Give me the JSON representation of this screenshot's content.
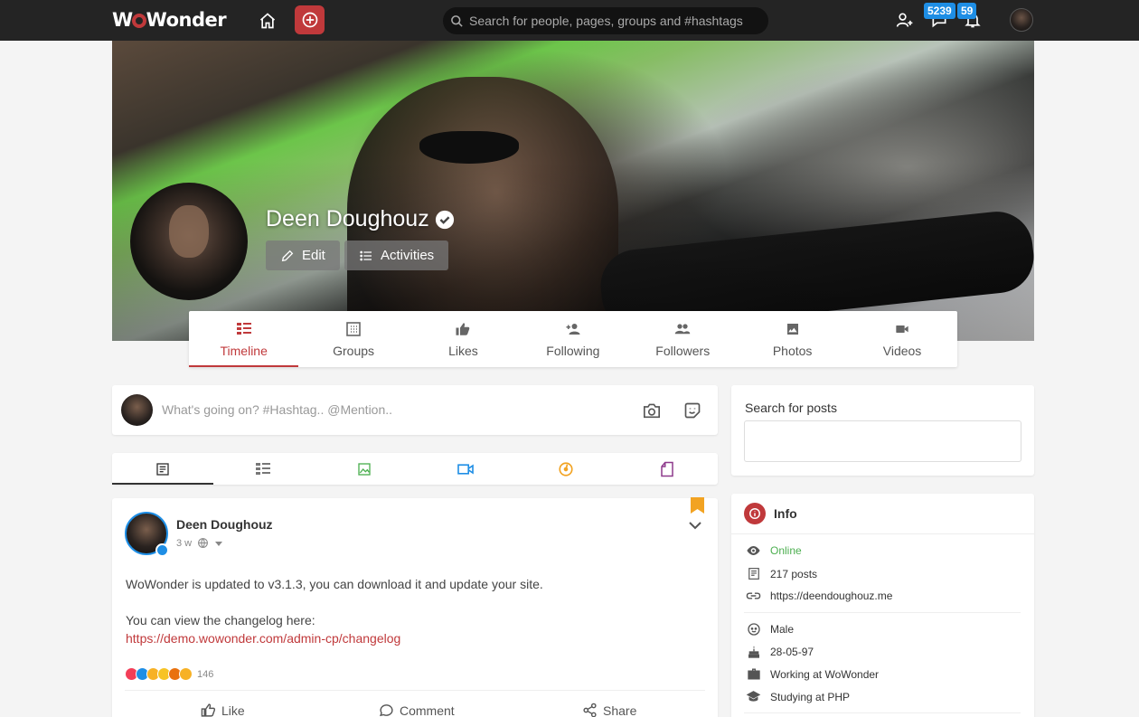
{
  "app": {
    "logo_text_1": "W",
    "logo_text_2": "Wonder"
  },
  "topbar": {
    "search_placeholder": "Search for people, pages, groups and #hashtags",
    "messages_count": "5239",
    "notifications_count": "59"
  },
  "profile": {
    "name": "Deen Doughouz",
    "edit_label": "Edit",
    "activities_label": "Activities"
  },
  "tabs": [
    {
      "label": "Timeline",
      "icon": "timeline-icon"
    },
    {
      "label": "Groups",
      "icon": "groups-icon"
    },
    {
      "label": "Likes",
      "icon": "thumbs-up-icon"
    },
    {
      "label": "Following",
      "icon": "person-add-icon"
    },
    {
      "label": "Followers",
      "icon": "people-icon"
    },
    {
      "label": "Photos",
      "icon": "image-icon"
    },
    {
      "label": "Videos",
      "icon": "video-icon"
    }
  ],
  "composer": {
    "placeholder": "What's going on? #Hashtag.. @Mention.."
  },
  "post": {
    "author": "Deen Doughouz",
    "time": "3 w",
    "text1": "WoWonder is updated to v3.1.3, you can download it and update your site.",
    "text2": "You can view the changelog here:",
    "link": "https://demo.wowonder.com/admin-cp/changelog",
    "reactions_count": "146",
    "like_label": "Like",
    "comment_label": "Comment",
    "share_label": "Share"
  },
  "sidebar": {
    "search_label": "Search for posts",
    "info_title": "Info",
    "info": {
      "status": "Online",
      "posts": "217 posts",
      "website": "https://deendoughouz.me",
      "gender": "Male",
      "birthday": "28-05-97",
      "work": "Working at WoWonder",
      "study": "Studying at PHP"
    }
  },
  "colors": {
    "accent": "#c0393b",
    "online": "#4caf50",
    "badge": "#1e8ee5",
    "bookmark": "#f2a322"
  }
}
